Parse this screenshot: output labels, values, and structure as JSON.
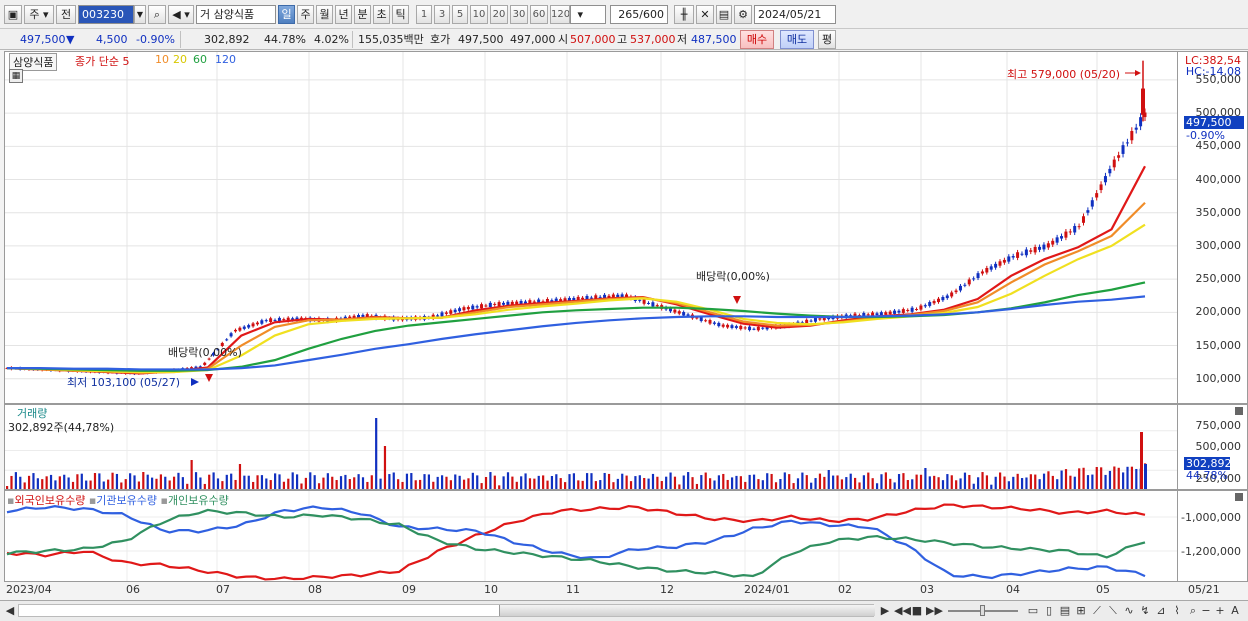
{
  "toolbar": {
    "market": "주",
    "prev": "전",
    "code": "003230",
    "type_tag": "거",
    "stock_name": "삼양식품",
    "periods": [
      "일",
      "주",
      "월",
      "년",
      "분",
      "초",
      "틱"
    ],
    "active_period": "일",
    "intervals": [
      "1",
      "3",
      "5",
      "10",
      "20",
      "30",
      "60",
      "120"
    ],
    "count_current": "265",
    "count_total": "/600",
    "date": "2024/05/21"
  },
  "quote": {
    "price": "497,500",
    "change_arrow": "▼",
    "change": "4,500",
    "change_pct": "-0.90%",
    "volume": "302,892",
    "volume_ratio": "44.78%",
    "turnover": "4.02%",
    "amount": "155,035백만",
    "ask_label": "호가",
    "ask": "497,500",
    "bid": "497,000",
    "open_label": "시",
    "open": "507,000",
    "high_label": "고",
    "high": "537,000",
    "low_label": "저",
    "low": "487,500",
    "buy_button": "매수",
    "sell_button": "매도",
    "avg_button": "평"
  },
  "price_legend": {
    "name": "삼양식품",
    "item": "종가 단순 5",
    "ma10": "10",
    "ma20": "20",
    "ma60": "60",
    "ma120": "120"
  },
  "price_annotations": {
    "high_note": "최고 579,000 (05/20)",
    "low_note": "최저 103,100 (05/27)",
    "dividend_1": "배당락(0,00%)",
    "dividend_2": "배당락(0,00%)",
    "lc": "LC:382,54",
    "hc": "HC:-14,08",
    "current_price": "497,500",
    "current_pct": "-0.90%"
  },
  "volume_pane": {
    "title": "거래량",
    "value": "302,892주(44,78%)",
    "current": "302,892",
    "ratio": "44.78%"
  },
  "holdings_pane": {
    "legend": [
      "외국인보유수량",
      "기관보유수량",
      "개인보유수량"
    ]
  },
  "colors": {
    "up": "#d01010",
    "down": "#1030c0",
    "ma5": "#e01818",
    "ma10": "#f08c28",
    "ma20": "#f0e020",
    "ma60": "#20a040",
    "ma120": "#3060e0",
    "foreign": "#e01818",
    "institution": "#3060e0",
    "individual": "#309060"
  },
  "x_axis": [
    "2023/04",
    "06",
    "07",
    "08",
    "09",
    "10",
    "11",
    "12",
    "2024/01",
    "02",
    "03",
    "04",
    "05",
    "05/21"
  ],
  "chart_data": [
    {
      "type": "line",
      "title": "",
      "y_ticks": [
        100000,
        150000,
        200000,
        250000,
        300000,
        350000,
        400000,
        450000,
        500000,
        550000
      ],
      "y_tick_labels": [
        "100,000",
        "150,000",
        "200,000",
        "250,000",
        "300,000",
        "350,000",
        "400,000",
        "450,000",
        "500,000",
        "550,000"
      ],
      "ylim": [
        80000,
        580000
      ],
      "x_months": [
        "2023/04",
        "06",
        "07",
        "08",
        "09",
        "10",
        "11",
        "12",
        "2024/01",
        "02",
        "03",
        "04",
        "05"
      ],
      "series": [
        {
          "name": "종가",
          "values": [
            116000,
            114000,
            112000,
            110000,
            108000,
            112000,
            118000,
            172000,
            188000,
            190000,
            188000,
            195000,
            190000,
            192000,
            205000,
            212000,
            215000,
            218000,
            222000,
            225000,
            210000,
            195000,
            180000,
            175000,
            180000,
            190000,
            195000,
            198000,
            205000,
            225000,
            260000,
            285000,
            300000,
            330000,
            420000,
            497500
          ]
        },
        {
          "name": "5",
          "values": [
            116000,
            114000,
            112000,
            110000,
            108000,
            111000,
            117000,
            165000,
            185000,
            190000,
            189000,
            193000,
            191000,
            192000,
            203000,
            210000,
            214000,
            217000,
            221000,
            223000,
            212000,
            197000,
            183000,
            177000,
            180000,
            188000,
            194000,
            197000,
            204000,
            220000,
            255000,
            280000,
            298000,
            325000,
            420000
          ]
        },
        {
          "name": "10",
          "values": [
            116000,
            114000,
            112000,
            111000,
            109000,
            110000,
            115000,
            150000,
            178000,
            188000,
            189000,
            192000,
            191000,
            192000,
            200000,
            208000,
            212000,
            216000,
            220000,
            222000,
            214000,
            200000,
            186000,
            180000,
            181000,
            186000,
            192000,
            196000,
            202000,
            215000,
            245000,
            272000,
            292000,
            315000,
            365000
          ]
        },
        {
          "name": "20",
          "values": [
            116000,
            115000,
            113000,
            111000,
            110000,
            110000,
            113000,
            135000,
            165000,
            182000,
            187000,
            190000,
            191000,
            192000,
            197000,
            204000,
            209000,
            213000,
            218000,
            221000,
            216000,
            204000,
            190000,
            184000,
            182000,
            185000,
            190000,
            194000,
            199000,
            208000,
            228000,
            255000,
            280000,
            300000,
            332000
          ]
        },
        {
          "name": "60",
          "values": [
            116000,
            115000,
            114000,
            113000,
            112000,
            112000,
            113000,
            118000,
            128000,
            145000,
            160000,
            172000,
            180000,
            185000,
            190000,
            195000,
            200000,
            203000,
            205000,
            207000,
            207000,
            205000,
            202000,
            198000,
            195000,
            193000,
            193000,
            194000,
            196000,
            200000,
            206000,
            215000,
            226000,
            234000,
            245000
          ]
        },
        {
          "name": "120",
          "values": [
            116000,
            116000,
            115000,
            115000,
            114000,
            114000,
            114000,
            116000,
            120000,
            128000,
            136000,
            145000,
            152000,
            160000,
            167000,
            173000,
            179000,
            184000,
            188000,
            191000,
            193000,
            194000,
            194000,
            193000,
            193000,
            193000,
            194000,
            195000,
            197000,
            200000,
            205000,
            211000,
            216000,
            219000,
            224000
          ]
        }
      ]
    },
    {
      "type": "bar",
      "title": "거래량",
      "y_tick_labels": [
        "750,000",
        "500,000",
        "250,000"
      ],
      "ylim": [
        0,
        1000000
      ]
    },
    {
      "type": "line",
      "title": "",
      "y_tick_labels": [
        "-1,000,000",
        "-1,200,000"
      ],
      "series": [
        {
          "name": "외국인보유수량"
        },
        {
          "name": "기관보유수량"
        },
        {
          "name": "개인보유수량"
        }
      ]
    }
  ]
}
